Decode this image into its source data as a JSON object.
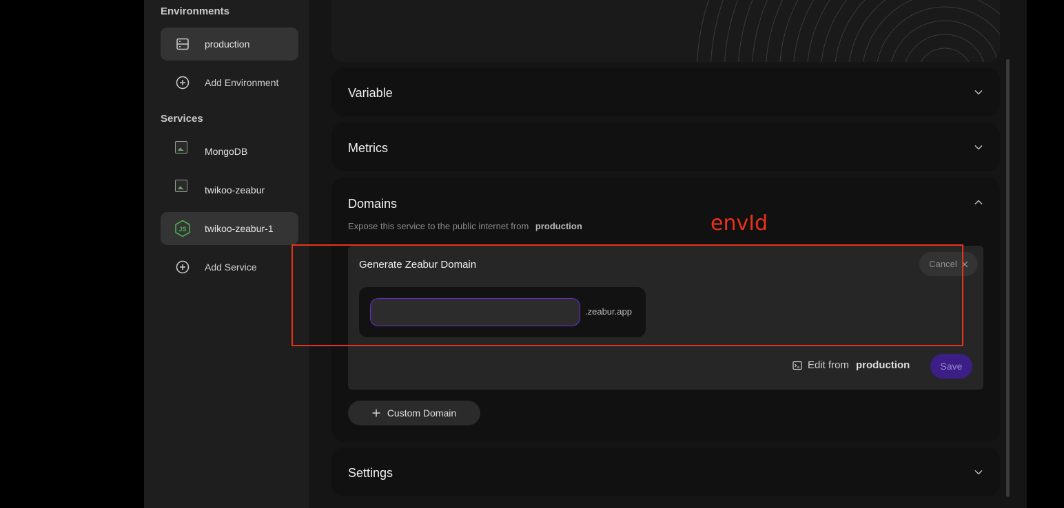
{
  "sidebar": {
    "environments_heading": "Environments",
    "environments": [
      {
        "label": "production",
        "icon": "server-icon",
        "active": true
      },
      {
        "label": "Add Environment",
        "icon": "plus-circle-icon",
        "active": false
      }
    ],
    "services_heading": "Services",
    "services": [
      {
        "label": "MongoDB",
        "icon": "broken-image-icon",
        "active": false
      },
      {
        "label": "twikoo-zeabur",
        "icon": "broken-image-icon",
        "active": false
      },
      {
        "label": "twikoo-zeabur-1",
        "icon": "nodejs-icon",
        "active": true
      },
      {
        "label": "Add Service",
        "icon": "plus-circle-icon",
        "active": false
      }
    ]
  },
  "panels": {
    "variable": "Variable",
    "metrics": "Metrics",
    "domains": "Domains",
    "settings": "Settings"
  },
  "domains": {
    "subtitle": "Expose this service to the public internet from",
    "environment": "production",
    "generate_title": "Generate Zeabur Domain",
    "cancel_label": "Cancel",
    "subdomain_value": "",
    "subdomain_placeholder": "",
    "suffix": ".zeabur.app",
    "edit_from_label": "Edit from",
    "edit_from_env": "production",
    "save_label": "Save",
    "custom_domain_label": "Custom Domain"
  },
  "annotation": {
    "label": "envId",
    "color": "#e8321a"
  },
  "colors": {
    "accent": "#6a2fd6",
    "save_bg": "#3b1e86",
    "nodejs_green": "#4caf50"
  }
}
